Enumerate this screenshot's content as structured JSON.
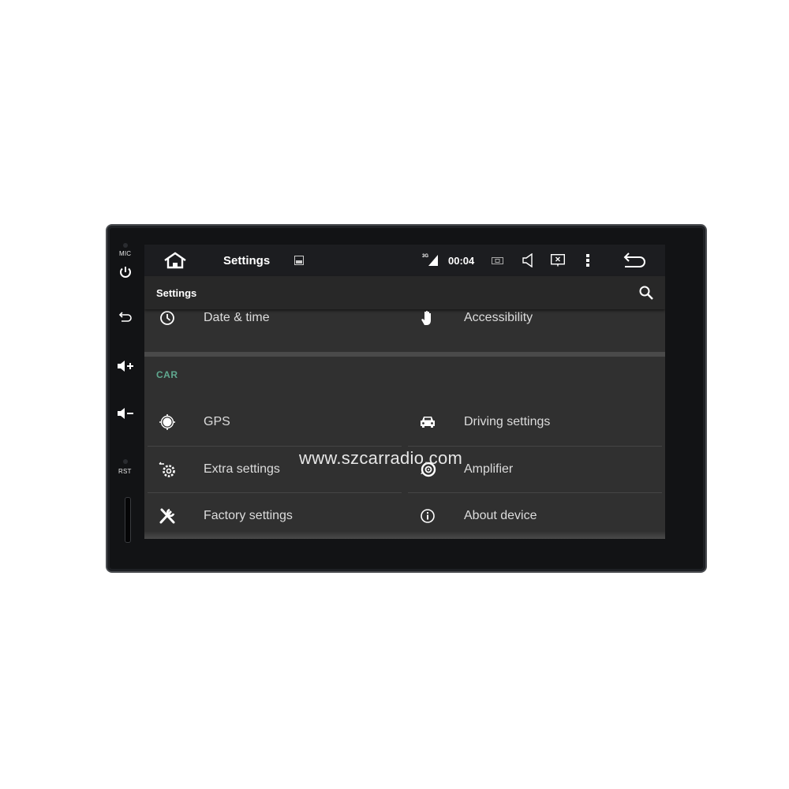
{
  "bezel": {
    "mic_label": "MIC",
    "rst_label": "RST",
    "buttons": [
      {
        "name": "power",
        "icon": "power-icon"
      },
      {
        "name": "back",
        "icon": "back-arrow-icon"
      },
      {
        "name": "volume-up",
        "icon": "volume-up-icon"
      },
      {
        "name": "volume-down",
        "icon": "volume-down-icon"
      }
    ]
  },
  "statusbar": {
    "home_icon": "home-icon",
    "title": "Settings",
    "image_icon": "image-icon",
    "network_label": "3G",
    "time": "00:04",
    "icons": [
      "camera-icon",
      "speaker-icon",
      "screen-off-icon",
      "more-vert-icon",
      "back-icon"
    ]
  },
  "appbar": {
    "title": "Settings",
    "search_icon": "search-icon"
  },
  "top_items": [
    {
      "label": "Date & time",
      "icon": "clock-icon"
    },
    {
      "label": "Accessibility",
      "icon": "hand-icon"
    }
  ],
  "section": {
    "title": "CAR",
    "items": [
      {
        "label": "GPS",
        "icon": "gps-icon"
      },
      {
        "label": "Driving settings",
        "icon": "car-icon"
      },
      {
        "label": "Extra settings",
        "icon": "extra-settings-icon"
      },
      {
        "label": "Amplifier",
        "icon": "amplifier-icon"
      },
      {
        "label": "Factory settings",
        "icon": "tools-icon"
      },
      {
        "label": "About device",
        "icon": "info-icon"
      }
    ]
  },
  "watermark": "www.szcarradio.com",
  "colors": {
    "accent": "#5fa88f",
    "screen_bg": "#303030",
    "statusbar_bg": "#1c1d20",
    "appbar_bg": "#282828"
  }
}
